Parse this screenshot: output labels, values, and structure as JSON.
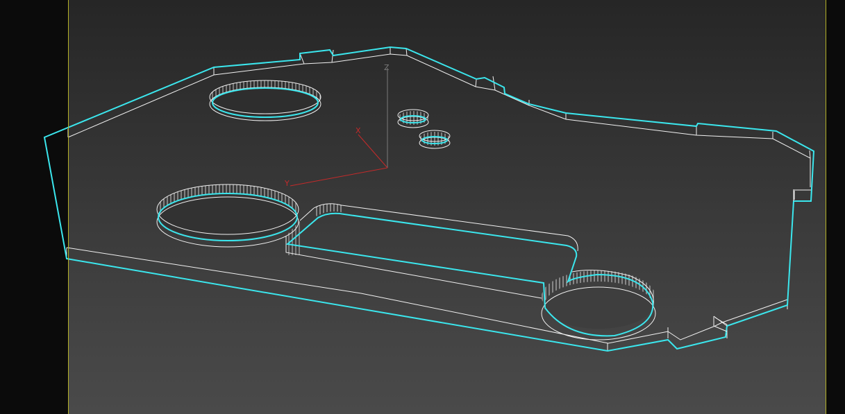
{
  "viewport": {
    "gizmo": {
      "x_label": "X",
      "y_label": "Y",
      "z_label": "Z"
    },
    "colors": {
      "selection": "#3be7ee",
      "wire": "#f2f2f2",
      "x_axis": "#c42a2a",
      "y_axis": "#c42a2a",
      "z_axis": "#7a7a7a",
      "safe_frame": "#b5b227"
    }
  }
}
